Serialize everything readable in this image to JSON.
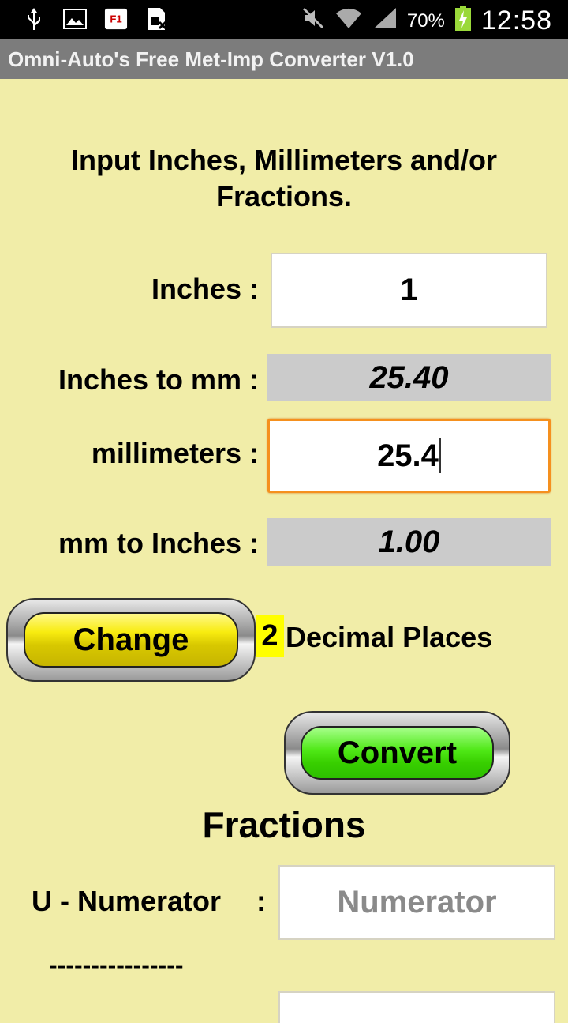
{
  "status_bar": {
    "icons_left": [
      "usb-icon",
      "image-icon",
      "f1-app-icon",
      "sim-icon"
    ],
    "icons_right": [
      "mute-icon",
      "wifi-icon",
      "signal-icon"
    ],
    "battery": "70%",
    "time": "12:58"
  },
  "app_title": "Omni-Auto's Free Met-Imp Converter V1.0",
  "heading": {
    "line1": "Input  Inches, Millimeters and/or",
    "line2": "Fractions."
  },
  "inches": {
    "label": "Inches :",
    "value": "1"
  },
  "inches_to_mm": {
    "label": "Inches to mm :",
    "value": "25.40"
  },
  "millimeters": {
    "label": "millimeters :",
    "value": "25.4"
  },
  "mm_to_inches": {
    "label": "mm to Inches :",
    "value": "1.00"
  },
  "decimal": {
    "change_label": "Change",
    "places_value": "2",
    "places_text": "Decimal Places"
  },
  "convert_label": "Convert",
  "fractions": {
    "title": "Fractions",
    "numerator_label": "U - Numerator",
    "numerator_colon": ":",
    "numerator_placeholder": "Numerator",
    "divider": "----------------"
  },
  "colors": {
    "background": "#f1eda8",
    "title_bar": "#7c7c7c",
    "result_bg": "#cbcbcb",
    "focus_border": "#f5901e",
    "change_button": "#f8ec10",
    "convert_button": "#4fe816"
  }
}
